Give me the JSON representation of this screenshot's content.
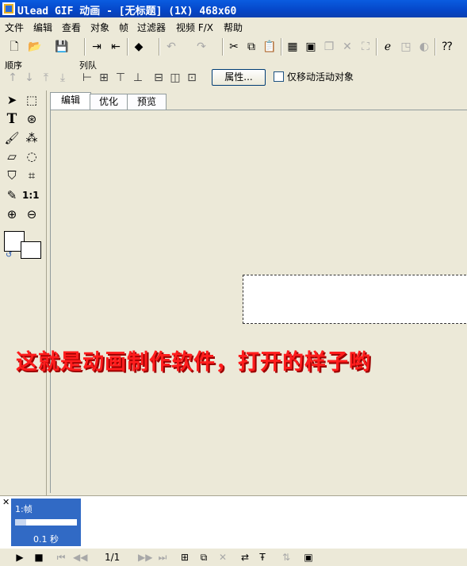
{
  "window": {
    "title": "Ulead GIF 动画 - [无标题] (1X) 468x60"
  },
  "menu": [
    "文件",
    "编辑",
    "查看",
    "对象",
    "帧",
    "过滤器",
    "视频 F/X",
    "帮助"
  ],
  "groups": {
    "order": "顺序",
    "queue": "列队"
  },
  "props": {
    "button": "属性...",
    "checkbox": "仅移动活动对象"
  },
  "tabs": [
    "编辑",
    "优化",
    "预览"
  ],
  "tools": {
    "text_glyph": "T",
    "ratio": "1:1"
  },
  "overlay": {
    "caption": "这就是动画制作软件，打开的样子哟"
  },
  "frames": [
    {
      "label": "1:帧",
      "delay": "0.1 秒"
    }
  ],
  "frame_nav": {
    "counter": "1/1"
  },
  "colors": {
    "title_bar": "#0a5ce0",
    "overlay_text": "#ff1d1d",
    "frame_selected": "#316ac5",
    "face": "#ece9d8"
  }
}
